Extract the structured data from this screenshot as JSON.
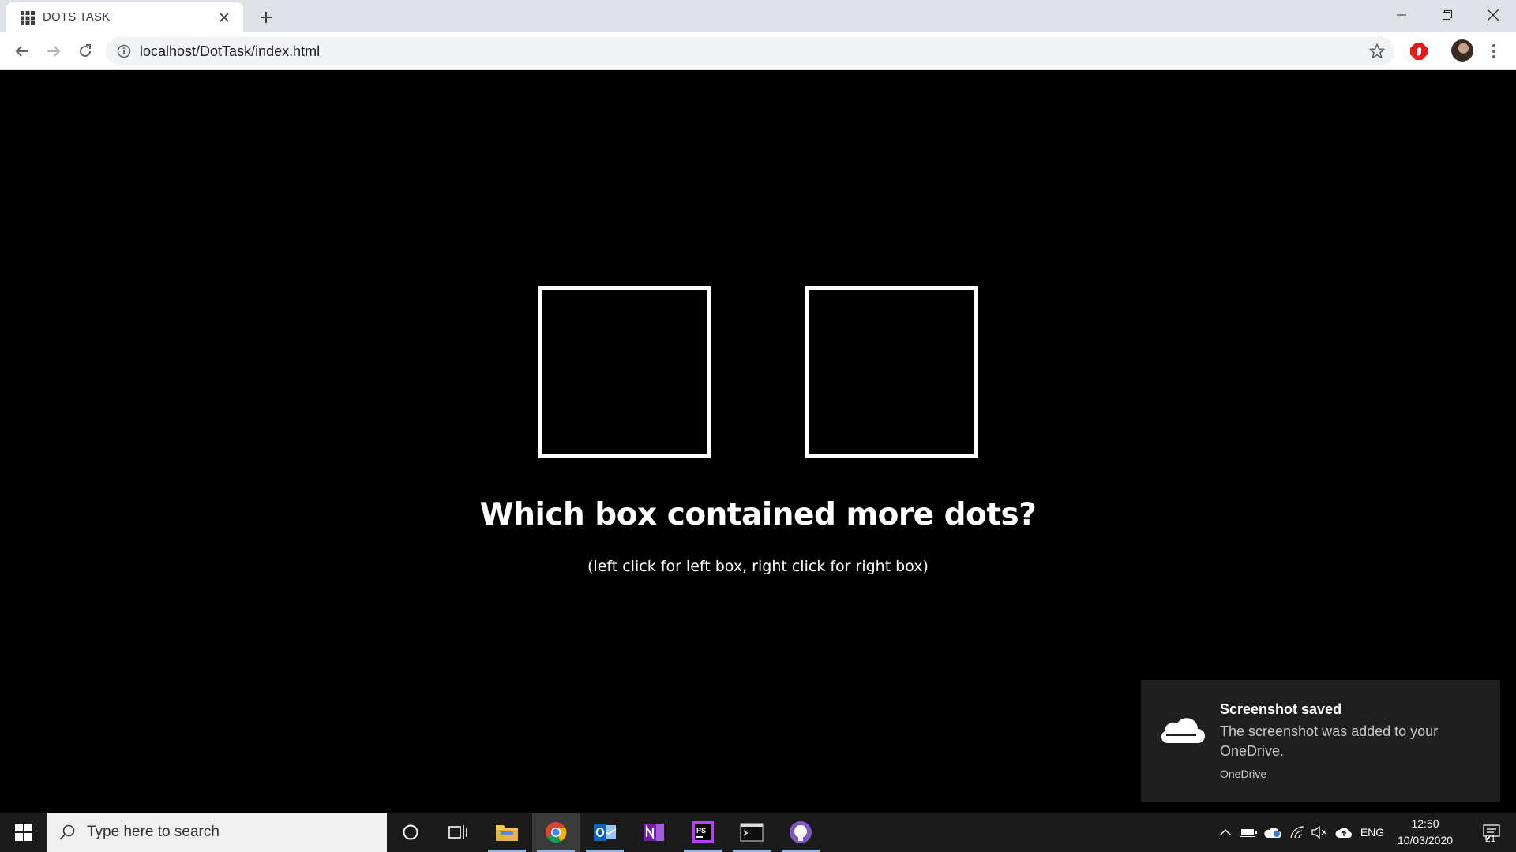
{
  "browser": {
    "tab_title": "DOTS TASK",
    "url": "localhost/DotTask/index.html"
  },
  "page": {
    "question": "Which box contained more dots?",
    "instruction": "(left click for left box, right click for right box)"
  },
  "toast": {
    "title": "Screenshot saved",
    "body": "The screenshot was added to your OneDrive.",
    "app": "OneDrive"
  },
  "taskbar": {
    "search_placeholder": "Type here to search",
    "apps": [
      "file-explorer-icon",
      "chrome-icon",
      "outlook-icon",
      "onenote-icon",
      "phpstorm-icon",
      "terminal-icon",
      "github-desktop-icon"
    ],
    "language": "ENG",
    "time": "12:50",
    "date": "10/03/2020",
    "notification_count": "21"
  },
  "colors": {
    "page_background": "#000000",
    "box_border": "#ffffff",
    "taskbar": "#1b1b1b",
    "toast": "#1f1f1f",
    "adblock_red": "#e31b1b"
  }
}
